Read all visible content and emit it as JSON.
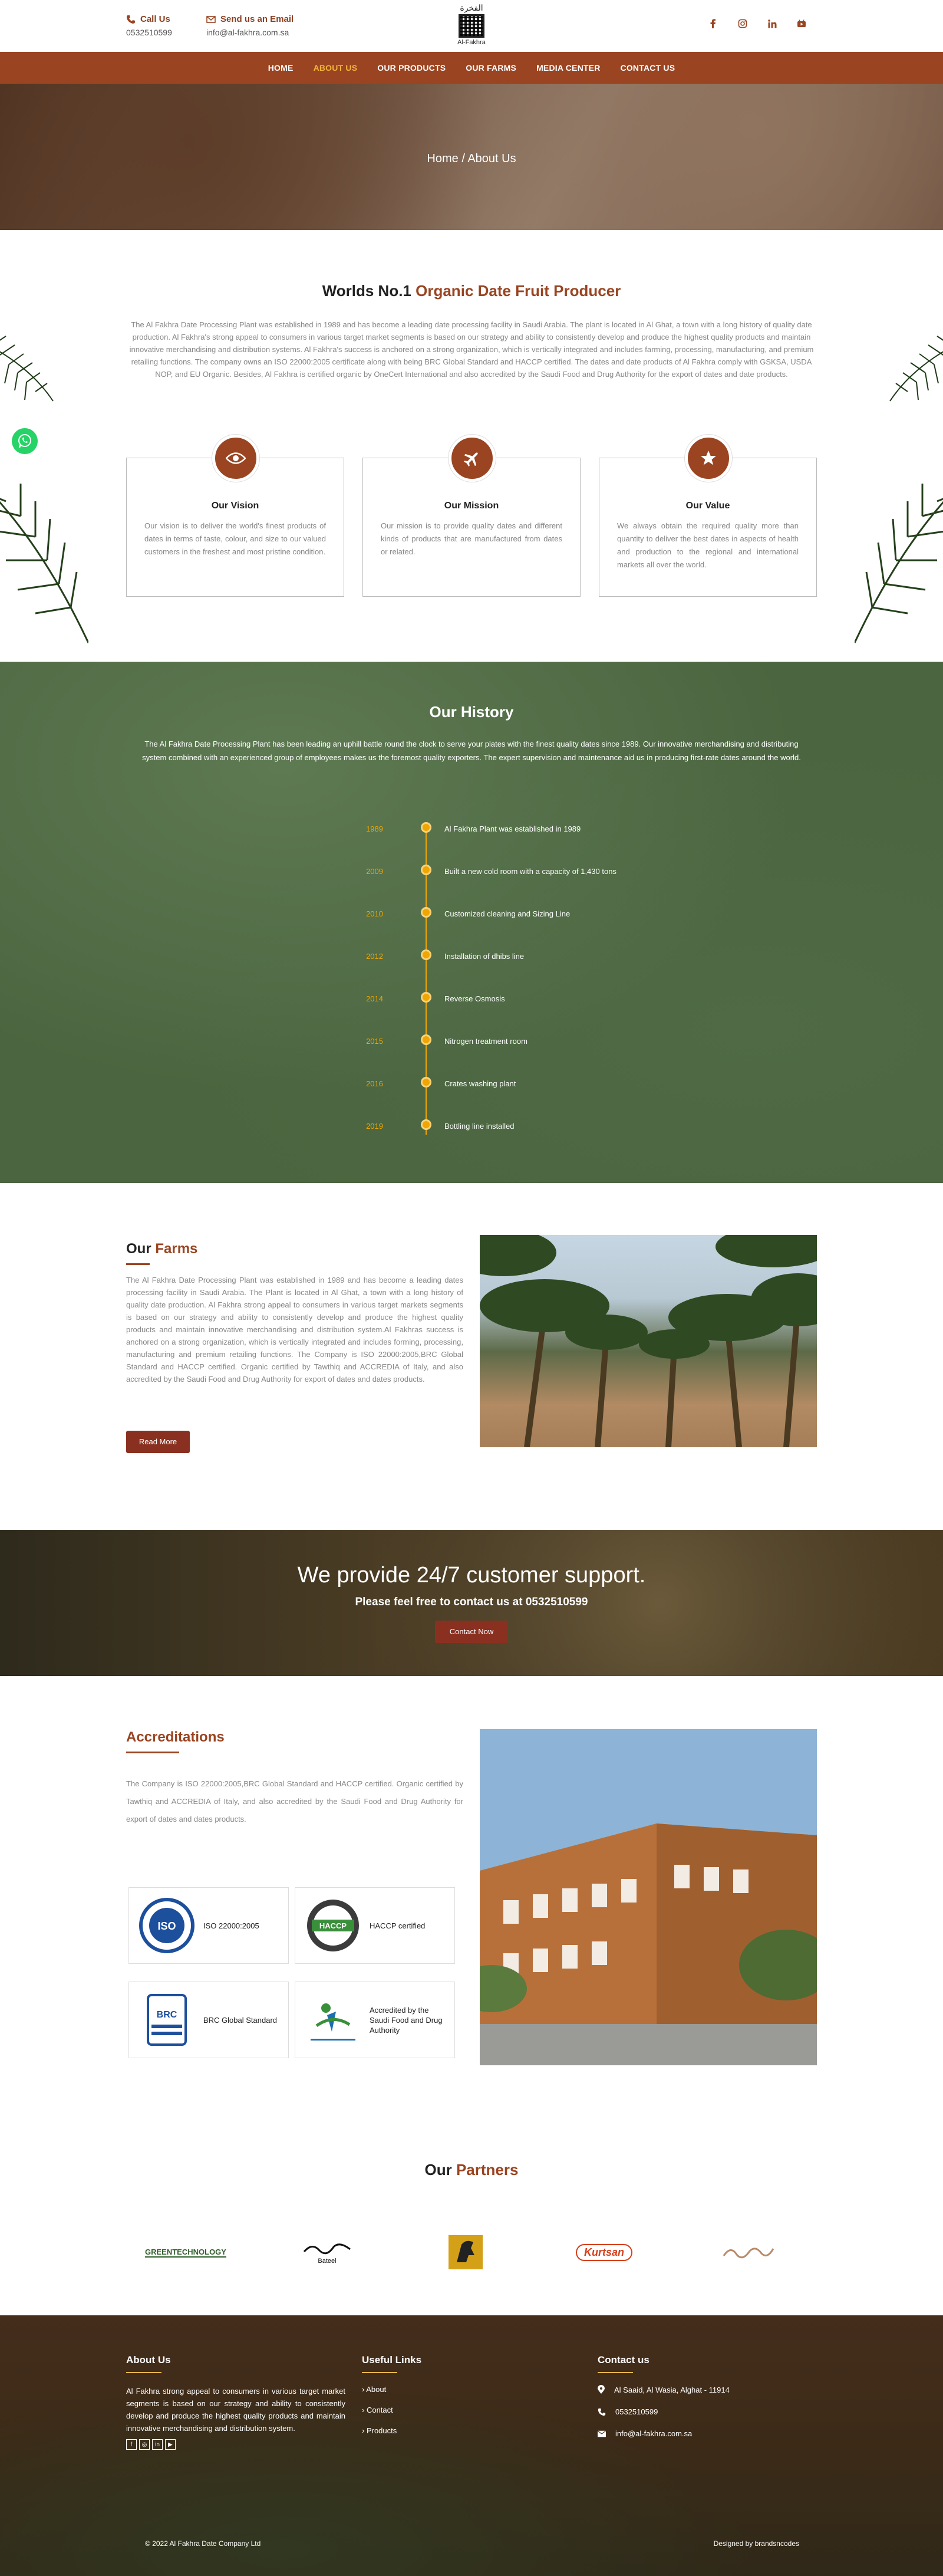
{
  "topbar": {
    "call_label": "Call Us",
    "call_value": "0532510599",
    "email_label": "Send us an Email",
    "email_value": "info@al-fakhra.com.sa",
    "logo_ar": "الفخرة",
    "logo_en": "Al-Fakhra",
    "social": [
      "facebook-icon",
      "instagram-icon",
      "linkedin-icon",
      "youtube-icon"
    ]
  },
  "nav": {
    "items": [
      "HOME",
      "ABOUT US",
      "OUR PRODUCTS",
      "OUR FARMS",
      "MEDIA CENTER",
      "CONTACT US"
    ],
    "active": "ABOUT US"
  },
  "hero": {
    "breadcrumb": "Home / About Us"
  },
  "about": {
    "title_a": "Worlds No.1 ",
    "title_b": "Organic Date Fruit Producer",
    "text": "The Al Fakhra Date Processing Plant was established in 1989 and has become a leading date processing facility in Saudi Arabia. The plant is located in Al Ghat, a town with a long history of quality date production. Al Fakhra's strong appeal to consumers in various target market segments is based on our strategy and ability to consistently develop and produce the highest quality products and maintain innovative merchandising and distribution systems. Al Fakhra's success is anchored on a strong organization, which is vertically integrated and includes farming, processing, manufacturing, and premium retailing functions. The company owns an ISO 22000:2005 certificate along with being BRC Global Standard and HACCP certified. The dates and date products of Al Fakhra comply with GSKSA, USDA NOP, and EU Organic. Besides, Al Fakhra is certified organic by OneCert International and also accredited by the Saudi Food and Drug Authority for the export of dates and date products."
  },
  "cards": [
    {
      "icon": "eye-icon",
      "title": "Our Vision",
      "text": "Our vision is to deliver the world's finest products of dates in terms of taste, colour, and size to our valued customers in the freshest and most pristine condition."
    },
    {
      "icon": "plane-icon",
      "title": "Our Mission",
      "text": "Our mission is to provide quality dates and different kinds of products that are manufactured from dates or related."
    },
    {
      "icon": "star-icon",
      "title": "Our Value",
      "text": "We always obtain the required quality more than quantity to deliver the best dates in aspects of health and production to the regional and international markets all over the world."
    }
  ],
  "history": {
    "title": "Our History",
    "intro": "The Al Fakhra Date Processing Plant has been leading an uphill battle round the clock to serve your plates with the finest quality dates since 1989. Our innovative merchandising and distributing system combined with an experienced group of employees makes us the foremost quality exporters. The expert supervision and maintenance aid us in producing first-rate dates around the world.",
    "events": [
      {
        "year": "1989",
        "text": "Al Fakhra Plant was established in 1989"
      },
      {
        "year": "2009",
        "text": "Built a new cold room with a capacity of 1,430 tons"
      },
      {
        "year": "2010",
        "text": "Customized cleaning and Sizing Line"
      },
      {
        "year": "2012",
        "text": "Installation of dhibs line"
      },
      {
        "year": "2014",
        "text": "Reverse Osmosis"
      },
      {
        "year": "2015",
        "text": "Nitrogen treatment room"
      },
      {
        "year": "2016",
        "text": "Crates washing plant"
      },
      {
        "year": "2019",
        "text": "Bottling line installed"
      }
    ]
  },
  "farms": {
    "title_a": "Our ",
    "title_b": "Farms",
    "text": "The Al Fakhra Date Processing Plant was established in 1989 and has become a leading dates processing facility in Saudi Arabia. The Plant is located in Al Ghat, a town with a long history of quality date production. Al Fakhra strong appeal to consumers in various target markets segments is based on our strategy and ability to consistently develop and produce the highest quality products and maintain innovative merchandising and distribution system.Al Fakhras success is anchored on a strong organization, which is vertically integrated and includes forming, processing, manufacturing and premium retailing functions. The Company is ISO 22000:2005,BRC Global Standard and HACCP certified. Organic certified by Tawthiq and ACCREDIA of Italy, and also accredited by the Saudi Food and Drug Authority for export of dates and dates products.",
    "button": "Read More"
  },
  "support": {
    "title": "We provide 24/7 customer support.",
    "subtitle": "Please feel free to contact us at 0532510599",
    "button": "Contact Now"
  },
  "accreditations": {
    "title": "Accreditations",
    "text": "The Company is ISO 22000:2005,BRC Global Standard and HACCP certified. Organic certified by Tawthiq and ACCREDIA of Italy, and also accredited by the Saudi Food and Drug Authority for export of dates and dates products.",
    "items": [
      {
        "icon": "iso-logo",
        "label": "ISO 22000:2005",
        "logo_text": "ISO"
      },
      {
        "icon": "haccp-logo",
        "label": "HACCP certified",
        "logo_text": "HACCP"
      },
      {
        "icon": "brc-logo",
        "label": "BRC Global Standard",
        "logo_text": "BRC"
      },
      {
        "icon": "sfda-logo",
        "label": "Accredited by the Saudi Food and Drug Authority",
        "logo_text": ""
      }
    ]
  },
  "partners": {
    "title_a": "Our ",
    "title_b": "Partners",
    "items": [
      {
        "name": "GREENTECHNOLOGY",
        "color": "#2f5e2a"
      },
      {
        "name": "Bateel",
        "color": "#111111"
      },
      {
        "name": "",
        "color": "#d4a017"
      },
      {
        "name": "Kurtsan",
        "color": "#d8401c"
      },
      {
        "name": "",
        "color": "#b98a6a"
      }
    ]
  },
  "footer": {
    "about_title": "About Us",
    "about_text": "Al Fakhra strong appeal to consumers in various target market segments is based on our strategy and ability to consistently develop and produce the highest quality products and maintain innovative merchandising and distribution system.",
    "links_title": "Useful Links",
    "links": [
      "About",
      "Contact",
      "Products"
    ],
    "contact_title": "Contact us",
    "address": "Al Saaid, Al Wasia, Alghat - 11914",
    "phone": "0532510599",
    "email": "info@al-fakhra.com.sa",
    "copyright": "© 2022 Al Fakhra Date Company Ltd",
    "designed": "Designed by brandsncodes"
  }
}
